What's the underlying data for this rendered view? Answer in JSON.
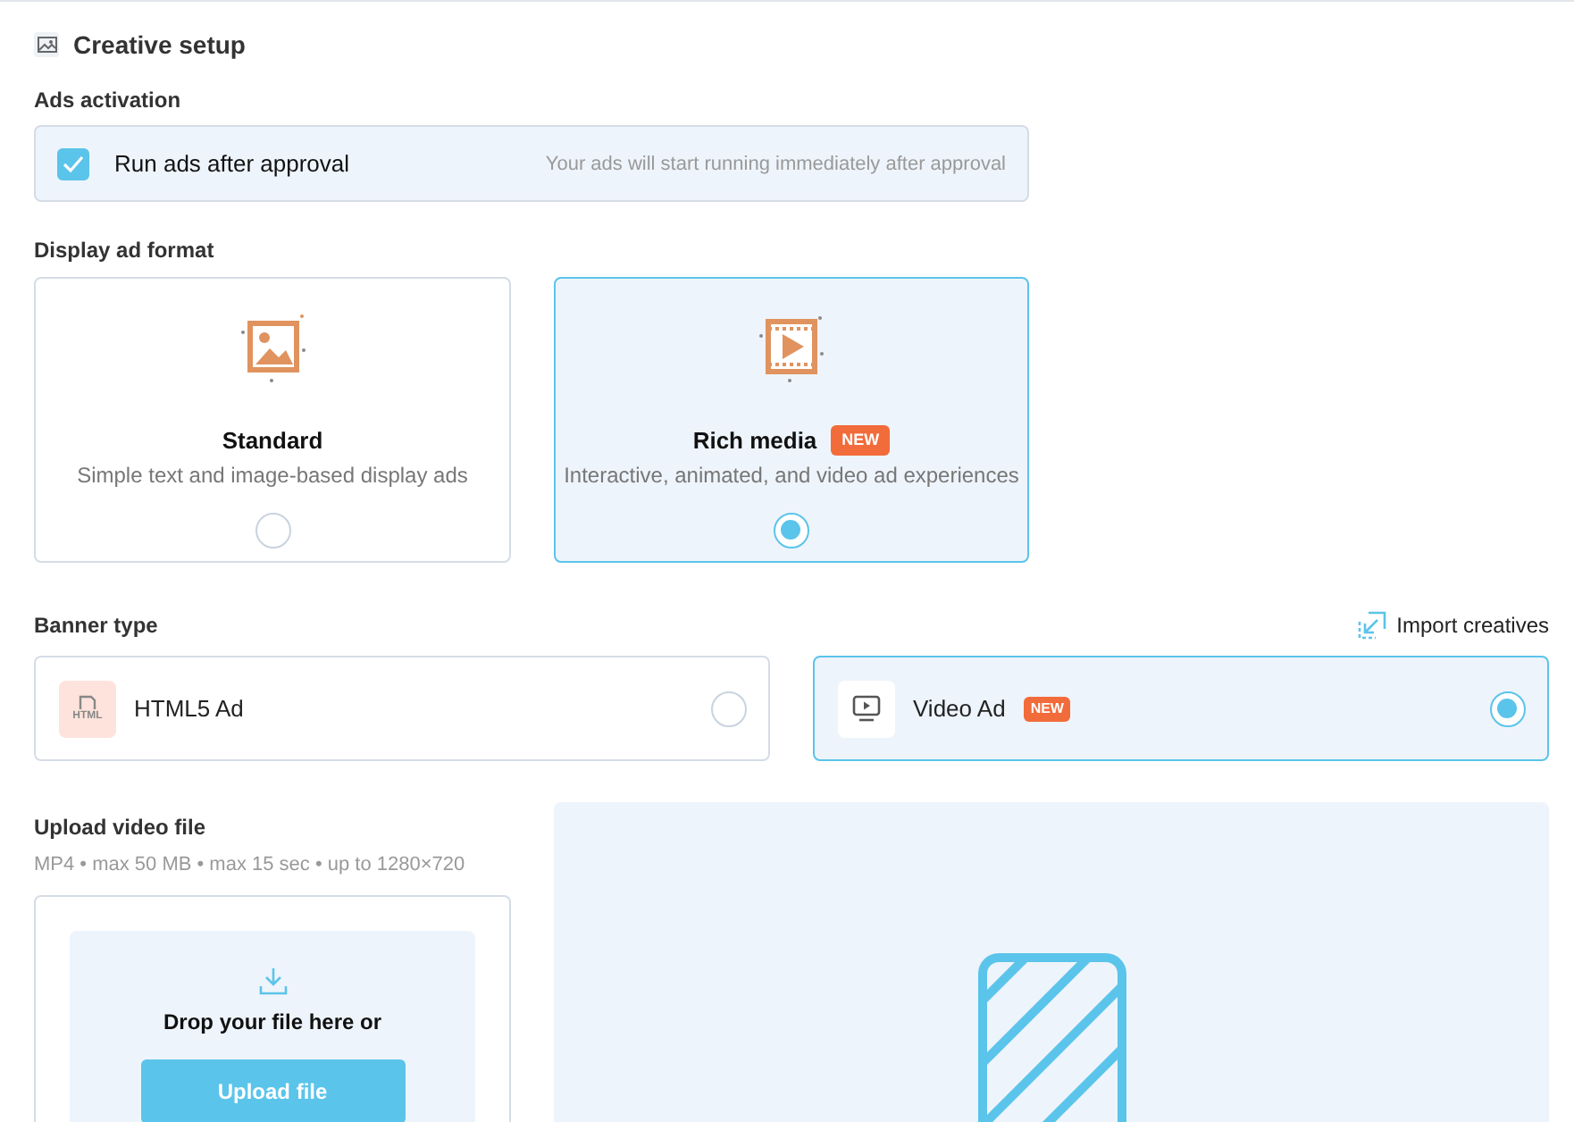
{
  "header": {
    "title": "Creative setup"
  },
  "ads_activation": {
    "label": "Ads activation",
    "option": {
      "label": "Run ads after approval",
      "hint": "Your ads will start running immediately after approval",
      "checked": true
    }
  },
  "display_format": {
    "label": "Display ad format",
    "options": [
      {
        "kind": "image",
        "title": "Standard",
        "description": "Simple text and image-based display ads",
        "selected": false
      },
      {
        "kind": "video",
        "title": "Rich media",
        "badge": "NEW",
        "description": "Interactive, animated, and video ad experiences",
        "selected": true
      }
    ]
  },
  "banner_type": {
    "label": "Banner type",
    "import_link": "Import creatives",
    "options": [
      {
        "kind": "html",
        "icon_text": "HTML",
        "label": "HTML5 Ad",
        "selected": false
      },
      {
        "kind": "video",
        "label": "Video Ad",
        "badge": "NEW",
        "selected": true
      }
    ]
  },
  "upload": {
    "label": "Upload video file",
    "spec": "MP4 • max 50 MB • max 15 sec • up to 1280×720",
    "drop_text": "Drop your file here or",
    "button": "Upload file"
  }
}
